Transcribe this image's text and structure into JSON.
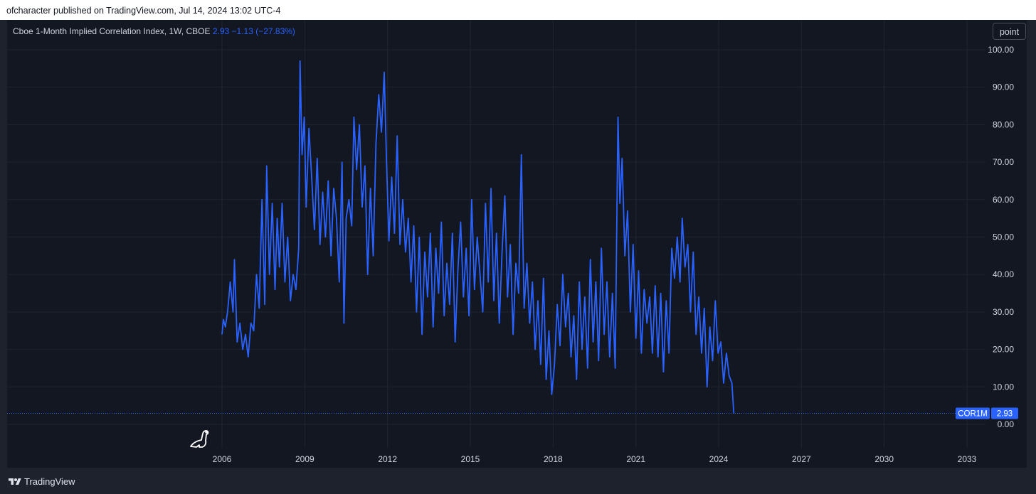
{
  "header": {
    "publish_info": "ofcharacter published on TradingView.com, Jul 14, 2024 13:02 UTC-4"
  },
  "legend": {
    "title": "Cboe 1-Month Implied Correlation Index, 1W, CBOE",
    "last": "2.93",
    "change": "−1.13 (−27.83%)"
  },
  "controls": {
    "scale_mode": "point"
  },
  "price_badge": {
    "symbol": "COR1M",
    "value": "2.93"
  },
  "footer": {
    "brand": "TradingView"
  },
  "colors": {
    "line": "#2962ff",
    "background": "#131722",
    "frame": "#1e222d",
    "grid": "#1f2430",
    "text": "#d1d4dc"
  },
  "icons": {
    "brand": "tradingview-logo-icon",
    "watermark": "dinosaur-icon"
  },
  "chart_data": {
    "type": "line",
    "series": [
      {
        "values": [
          [
            2006.0,
            24
          ],
          [
            2006.05,
            28
          ],
          [
            2006.12,
            26
          ],
          [
            2006.2,
            30
          ],
          [
            2006.3,
            38
          ],
          [
            2006.4,
            30
          ],
          [
            2006.45,
            44
          ],
          [
            2006.55,
            22
          ],
          [
            2006.65,
            27
          ],
          [
            2006.75,
            20
          ],
          [
            2006.85,
            24
          ],
          [
            2006.95,
            18
          ],
          [
            2007.05,
            27
          ],
          [
            2007.15,
            25
          ],
          [
            2007.25,
            40
          ],
          [
            2007.35,
            31
          ],
          [
            2007.45,
            60
          ],
          [
            2007.55,
            32
          ],
          [
            2007.62,
            69
          ],
          [
            2007.72,
            40
          ],
          [
            2007.82,
            59
          ],
          [
            2007.92,
            36
          ],
          [
            2008.0,
            55
          ],
          [
            2008.08,
            42
          ],
          [
            2008.18,
            59
          ],
          [
            2008.28,
            38
          ],
          [
            2008.38,
            50
          ],
          [
            2008.48,
            33
          ],
          [
            2008.58,
            40
          ],
          [
            2008.68,
            36
          ],
          [
            2008.78,
            47
          ],
          [
            2008.83,
            97
          ],
          [
            2008.9,
            72
          ],
          [
            2008.98,
            82
          ],
          [
            2009.05,
            58
          ],
          [
            2009.15,
            79
          ],
          [
            2009.25,
            66
          ],
          [
            2009.35,
            52
          ],
          [
            2009.45,
            71
          ],
          [
            2009.55,
            48
          ],
          [
            2009.65,
            62
          ],
          [
            2009.75,
            50
          ],
          [
            2009.85,
            65
          ],
          [
            2009.95,
            45
          ],
          [
            2010.05,
            63
          ],
          [
            2010.15,
            55
          ],
          [
            2010.25,
            38
          ],
          [
            2010.35,
            70
          ],
          [
            2010.42,
            27
          ],
          [
            2010.5,
            55
          ],
          [
            2010.6,
            60
          ],
          [
            2010.7,
            53
          ],
          [
            2010.78,
            82
          ],
          [
            2010.88,
            68
          ],
          [
            2010.98,
            80
          ],
          [
            2011.08,
            58
          ],
          [
            2011.18,
            69
          ],
          [
            2011.28,
            40
          ],
          [
            2011.38,
            63
          ],
          [
            2011.48,
            45
          ],
          [
            2011.58,
            75
          ],
          [
            2011.68,
            88
          ],
          [
            2011.78,
            78
          ],
          [
            2011.88,
            94
          ],
          [
            2011.96,
            71
          ],
          [
            2012.05,
            49
          ],
          [
            2012.15,
            66
          ],
          [
            2012.25,
            51
          ],
          [
            2012.35,
            77
          ],
          [
            2012.45,
            48
          ],
          [
            2012.55,
            60
          ],
          [
            2012.65,
            46
          ],
          [
            2012.75,
            55
          ],
          [
            2012.85,
            38
          ],
          [
            2012.95,
            53
          ],
          [
            2013.05,
            30
          ],
          [
            2013.15,
            50
          ],
          [
            2013.25,
            24
          ],
          [
            2013.35,
            46
          ],
          [
            2013.45,
            34
          ],
          [
            2013.55,
            51
          ],
          [
            2013.65,
            26
          ],
          [
            2013.75,
            47
          ],
          [
            2013.85,
            35
          ],
          [
            2013.95,
            54
          ],
          [
            2014.05,
            29
          ],
          [
            2014.15,
            43
          ],
          [
            2014.25,
            32
          ],
          [
            2014.35,
            51
          ],
          [
            2014.45,
            22
          ],
          [
            2014.55,
            41
          ],
          [
            2014.65,
            54
          ],
          [
            2014.75,
            34
          ],
          [
            2014.85,
            47
          ],
          [
            2014.95,
            29
          ],
          [
            2015.05,
            60
          ],
          [
            2015.15,
            36
          ],
          [
            2015.25,
            50
          ],
          [
            2015.35,
            40
          ],
          [
            2015.45,
            30
          ],
          [
            2015.55,
            59
          ],
          [
            2015.65,
            38
          ],
          [
            2015.75,
            63
          ],
          [
            2015.85,
            33
          ],
          [
            2015.95,
            51
          ],
          [
            2016.05,
            27
          ],
          [
            2016.15,
            46
          ],
          [
            2016.25,
            61
          ],
          [
            2016.35,
            34
          ],
          [
            2016.45,
            48
          ],
          [
            2016.55,
            24
          ],
          [
            2016.65,
            43
          ],
          [
            2016.75,
            35
          ],
          [
            2016.85,
            72
          ],
          [
            2016.95,
            31
          ],
          [
            2017.05,
            43
          ],
          [
            2017.15,
            27
          ],
          [
            2017.25,
            38
          ],
          [
            2017.35,
            20
          ],
          [
            2017.45,
            33
          ],
          [
            2017.55,
            16
          ],
          [
            2017.65,
            39
          ],
          [
            2017.75,
            12
          ],
          [
            2017.85,
            25
          ],
          [
            2017.95,
            8
          ],
          [
            2018.05,
            16
          ],
          [
            2018.15,
            32
          ],
          [
            2018.25,
            21
          ],
          [
            2018.35,
            40
          ],
          [
            2018.45,
            26
          ],
          [
            2018.55,
            35
          ],
          [
            2018.65,
            18
          ],
          [
            2018.75,
            29
          ],
          [
            2018.85,
            12
          ],
          [
            2018.95,
            38
          ],
          [
            2019.05,
            20
          ],
          [
            2019.15,
            34
          ],
          [
            2019.25,
            15
          ],
          [
            2019.35,
            44
          ],
          [
            2019.45,
            22
          ],
          [
            2019.55,
            38
          ],
          [
            2019.65,
            17
          ],
          [
            2019.75,
            47
          ],
          [
            2019.85,
            24
          ],
          [
            2019.95,
            38
          ],
          [
            2020.05,
            18
          ],
          [
            2020.15,
            35
          ],
          [
            2020.25,
            15
          ],
          [
            2020.35,
            82
          ],
          [
            2020.42,
            59
          ],
          [
            2020.5,
            71
          ],
          [
            2020.6,
            45
          ],
          [
            2020.7,
            57
          ],
          [
            2020.8,
            30
          ],
          [
            2020.9,
            48
          ],
          [
            2021.0,
            23
          ],
          [
            2021.1,
            41
          ],
          [
            2021.2,
            19
          ],
          [
            2021.3,
            36
          ],
          [
            2021.4,
            27
          ],
          [
            2021.5,
            34
          ],
          [
            2021.6,
            19
          ],
          [
            2021.7,
            37
          ],
          [
            2021.8,
            18
          ],
          [
            2021.9,
            35
          ],
          [
            2022.0,
            14
          ],
          [
            2022.1,
            33
          ],
          [
            2022.2,
            19
          ],
          [
            2022.3,
            47
          ],
          [
            2022.4,
            39
          ],
          [
            2022.5,
            50
          ],
          [
            2022.6,
            38
          ],
          [
            2022.68,
            55
          ],
          [
            2022.78,
            42
          ],
          [
            2022.88,
            48
          ],
          [
            2022.98,
            30
          ],
          [
            2023.08,
            46
          ],
          [
            2023.18,
            24
          ],
          [
            2023.28,
            34
          ],
          [
            2023.38,
            19
          ],
          [
            2023.48,
            31
          ],
          [
            2023.58,
            10
          ],
          [
            2023.68,
            26
          ],
          [
            2023.78,
            17
          ],
          [
            2023.88,
            33
          ],
          [
            2023.98,
            19
          ],
          [
            2024.08,
            22
          ],
          [
            2024.18,
            11
          ],
          [
            2024.28,
            19
          ],
          [
            2024.38,
            13
          ],
          [
            2024.48,
            11
          ],
          [
            2024.55,
            2.93
          ]
        ]
      }
    ],
    "x_ticks": [
      "2006",
      "2009",
      "2012",
      "2015",
      "2018",
      "2021",
      "2024",
      "2027",
      "2030",
      "2033"
    ],
    "y_ticks": [
      "100.00",
      "90.00",
      "80.00",
      "70.00",
      "60.00",
      "50.00",
      "40.00",
      "30.00",
      "20.00",
      "10.00",
      "0.00"
    ],
    "xlim": [
      2006,
      2033
    ],
    "ylim": [
      0,
      100
    ],
    "last_value": 2.93,
    "grid": true,
    "legend_position": "top-left"
  }
}
